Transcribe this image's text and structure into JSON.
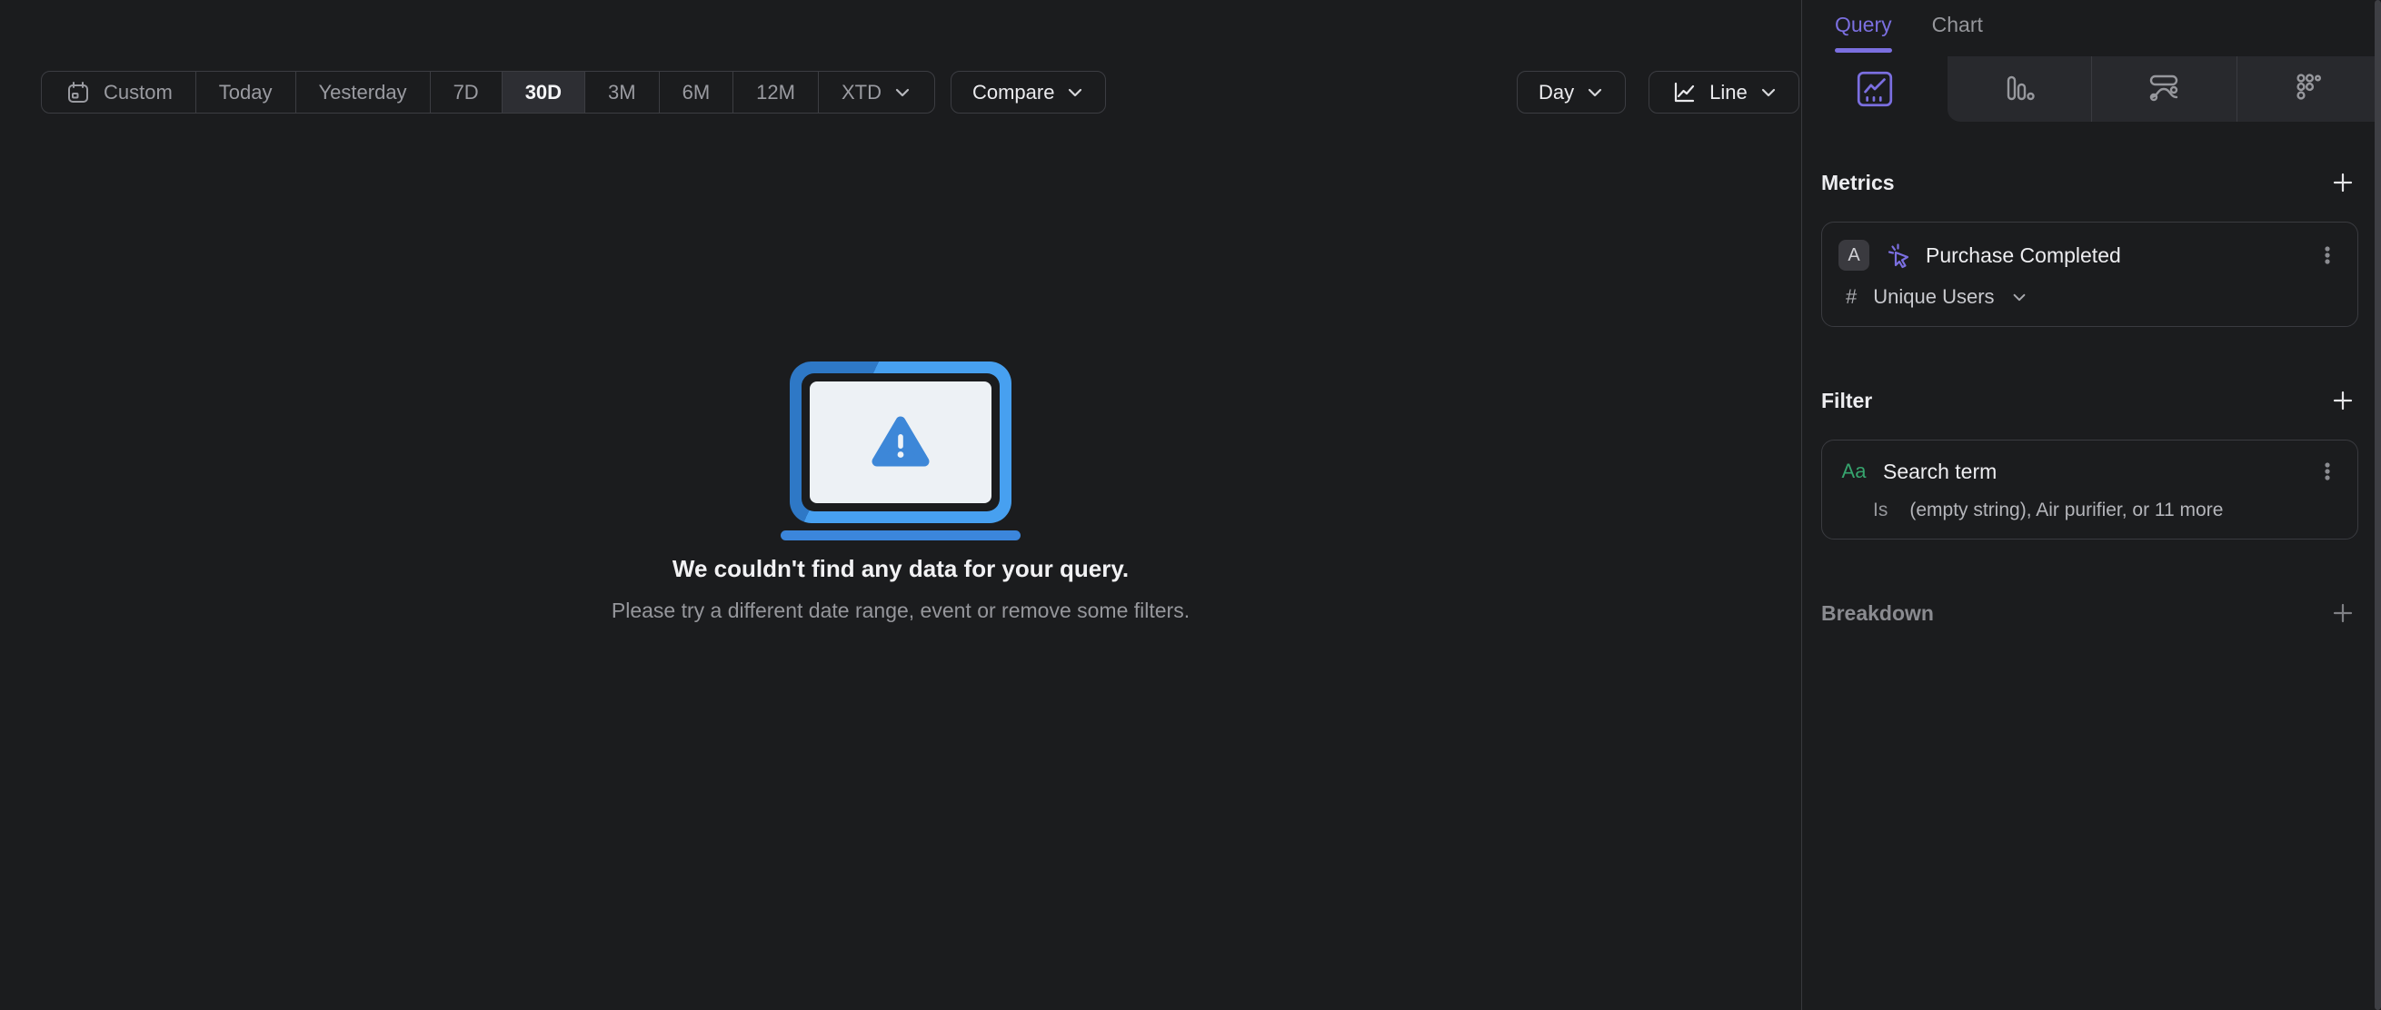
{
  "toolbar": {
    "date_ranges": [
      "Custom",
      "Today",
      "Yesterday",
      "7D",
      "30D",
      "3M",
      "6M",
      "12M",
      "XTD"
    ],
    "selected_range": "30D",
    "compare_label": "Compare",
    "granularity_label": "Day",
    "chart_type_label": "Line"
  },
  "sidebar": {
    "tabs": [
      {
        "label": "Query",
        "active": true
      },
      {
        "label": "Chart",
        "active": false
      }
    ],
    "chart_type_icons": [
      "insights-line-icon",
      "bar-chart-icon",
      "flows-icon",
      "retention-dots-icon"
    ],
    "metrics_section": {
      "title": "Metrics"
    },
    "metric": {
      "series_badge": "A",
      "event_icon": "event-cursor-icon",
      "event_name": "Purchase Completed",
      "aggregation_symbol": "#",
      "aggregation_label": "Unique Users"
    },
    "filter_section": {
      "title": "Filter"
    },
    "filter": {
      "type_label": "Aa",
      "property_name": "Search term",
      "operator": "Is",
      "values_summary": "(empty string), Air purifier, or 11 more"
    },
    "breakdown_section": {
      "title": "Breakdown"
    }
  },
  "empty_state": {
    "title": "We couldn't find any data for your query.",
    "subtitle": "Please try a different date range, event or remove some filters."
  },
  "colors": {
    "accent_purple": "#7b6fe0",
    "laptop_blue": "#47a0f0",
    "warning_blue": "#3d87d8",
    "filter_green": "#36a46e",
    "selected_segment_bg": "#2d2e33"
  }
}
